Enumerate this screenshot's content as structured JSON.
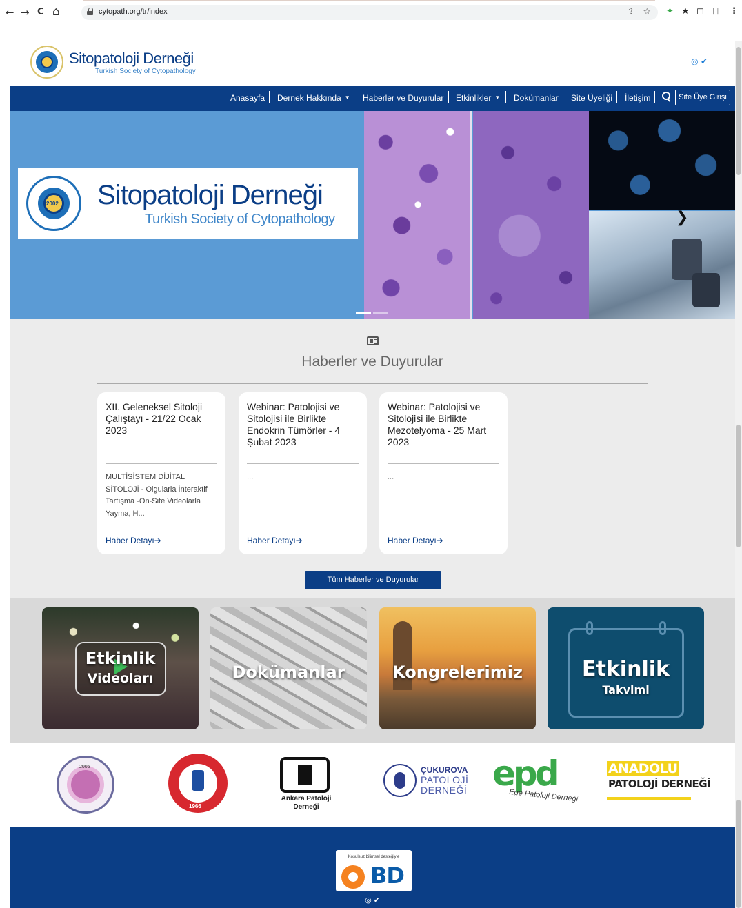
{
  "browser": {
    "url": "cytopath.org/tr/index",
    "back": "←",
    "forward": "→",
    "reload": "C",
    "home": "⌂",
    "share": "⇪",
    "star": "☆",
    "ext1": "✦",
    "ext2": "★",
    "ext3": "◻",
    "ext4": "ᛁᛁ",
    "menu": "⋮"
  },
  "header": {
    "logo_title": "Sitopatoloji Derneği",
    "logo_subtitle": "Turkish Society of Cytopathology",
    "social": "◎ ✔"
  },
  "nav": {
    "items": [
      "Anasayfa",
      "Dernek Hakkında",
      "Haberler ve Duyurular",
      "Etkinlikler",
      "Dokümanlar",
      "Site Üyeliği",
      "İletişim"
    ],
    "caret": "▼",
    "login": "Site Üye Girişi"
  },
  "hero": {
    "brand_title": "Sitopatoloji Derneği",
    "brand_subtitle": "Turkish Society of Cytopathology",
    "seal_year": "2002",
    "next": "❯",
    "slide_count": 2,
    "active_slide": 1
  },
  "news": {
    "title": "Haberler ve Duyurular",
    "cards": [
      {
        "title": "XII. Geleneksel Sitoloji Çalıştayı - 21/22 Ocak 2023",
        "excerpt": "MULTİSİSTEM DİJİTAL SİTOLOJİ - Olgularla İnteraktif Tartışma -On-Site Videolarla Yayma, H...",
        "link": "Haber Detayı"
      },
      {
        "title": "Webinar: Patolojisi ve Sitolojisi ile Birlikte Endokrin Tümörler - 4 Şubat 2023",
        "excerpt": "...",
        "link": "Haber Detayı"
      },
      {
        "title": "Webinar: Patolojisi ve Sitolojisi ile Birlikte Mezotelyoma - 25 Mart 2023",
        "excerpt": "...",
        "link": "Haber Detayı"
      }
    ],
    "link_arrow": "➔",
    "all_button": "Tüm Haberler ve Duyurular"
  },
  "tiles": [
    {
      "line1": "Etkinlik",
      "line2": "Videoları"
    },
    {
      "line1": "Dokümanlar"
    },
    {
      "line1": "Kongrelerimiz"
    },
    {
      "line1": "Etkinlik",
      "line2": "Takvimi"
    }
  ],
  "partners": {
    "pdf_year": "2005",
    "tpd_year": "1966",
    "apd_name": "Ankara Patoloji Derneği",
    "cpd_line1": "ÇUKUROVA",
    "cpd_line2": "PATOLOJİ",
    "cpd_line3": "DERNEĞİ",
    "epd_logo": "epd",
    "epd_name": "Ege Patoloji Derneği",
    "ana_line1": "ANADOLU",
    "ana_line2": "PATOLOJİ DERNEĞİ"
  },
  "footer": {
    "sponsor_note": "Koşulsuz bilimsel desteğiyle",
    "sponsor_name": "BD",
    "social": "◎ ✔"
  },
  "colors": {
    "brand_blue": "#0b3e86",
    "hero_blue": "#5b9bd5",
    "news_bg": "#ececec"
  }
}
